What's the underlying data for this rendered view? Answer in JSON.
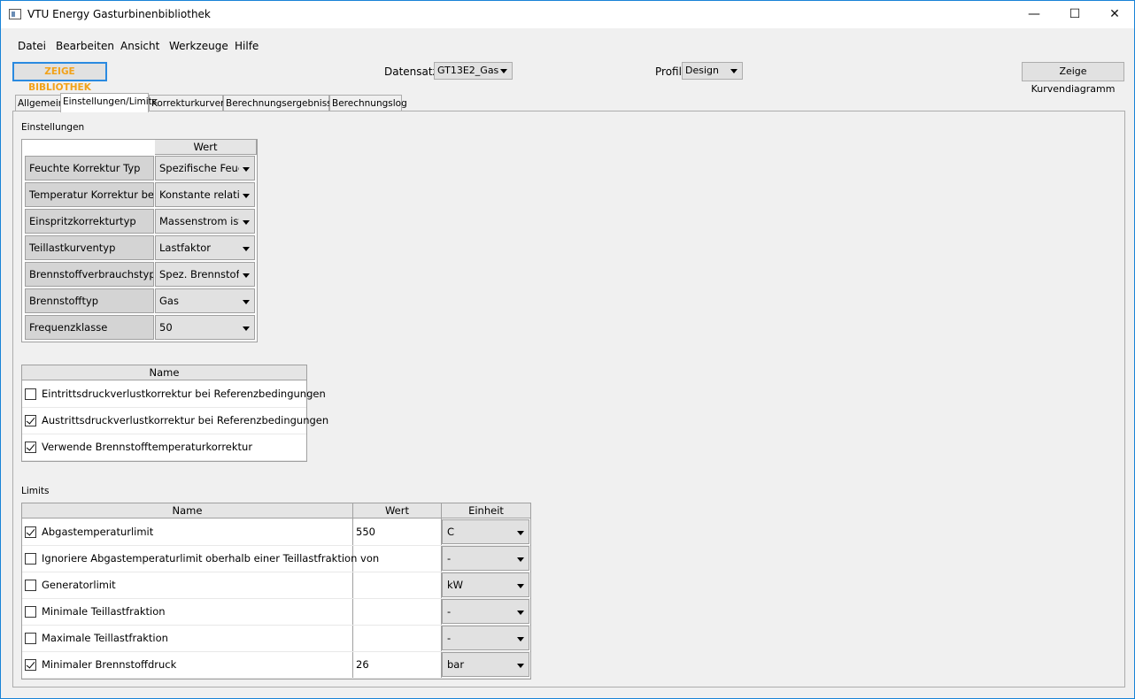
{
  "window": {
    "title": "VTU Energy Gasturbinenbibliothek"
  },
  "menu": [
    "Datei",
    "Bearbeiten",
    "Ansicht",
    "Werkzeuge",
    "Hilfe"
  ],
  "toolbar": {
    "library_button": "ZEIGE BIBLIOTHEK",
    "dataset_label": "Datensatz",
    "dataset_value": "GT13E2_Gas",
    "profile_label": "Profil",
    "profile_value": "Design",
    "curve_button": "Zeige Kurvendiagramm"
  },
  "tabs": [
    "Allgemein",
    "Einstellungen/Limits",
    "Korrekturkurven",
    "Berechnungsergebnisse",
    "Berechnungslog"
  ],
  "active_tab": "Einstellungen/Limits",
  "settings": {
    "section_label": "Einstellungen",
    "value_header": "Wert",
    "rows": [
      {
        "name": "Feuchte Korrektur Typ",
        "value": "Spezifische Feuchte"
      },
      {
        "name": "Temperatur Korrektur bei",
        "value": "Konstante relative"
      },
      {
        "name": "Einspritzkorrekturtyp",
        "value": "Massenstrom ist"
      },
      {
        "name": "Teillastkurventyp",
        "value": "Lastfaktor"
      },
      {
        "name": "Brennstoffverbrauchstyp",
        "value": "Spez. Brennstoffb"
      },
      {
        "name": "Brennstofftyp",
        "value": "Gas"
      },
      {
        "name": "Frequenzklasse",
        "value": "50"
      }
    ]
  },
  "options": {
    "name_header": "Name",
    "rows": [
      {
        "label": "Eintrittsdruckverlustkorrektur bei Referenzbedingungen",
        "checked": false
      },
      {
        "label": "Austrittsdruckverlustkorrektur bei Referenzbedingungen",
        "checked": true
      },
      {
        "label": "Verwende Brennstofftemperaturkorrektur",
        "checked": true
      }
    ]
  },
  "limits": {
    "section_label": "Limits",
    "headers": {
      "name": "Name",
      "value": "Wert",
      "unit": "Einheit"
    },
    "rows": [
      {
        "name": "Abgastemperaturlimit",
        "checked": true,
        "value": "550",
        "unit": "C"
      },
      {
        "name": "Ignoriere Abgastemperaturlimit oberhalb einer Teillastfraktion von",
        "checked": false,
        "value": "",
        "unit": "-"
      },
      {
        "name": "Generatorlimit",
        "checked": false,
        "value": "",
        "unit": "kW"
      },
      {
        "name": "Minimale Teillastfraktion",
        "checked": false,
        "value": "",
        "unit": "-"
      },
      {
        "name": "Maximale Teillastfraktion",
        "checked": false,
        "value": "",
        "unit": "-"
      },
      {
        "name": "Minimaler Brennstoffdruck",
        "checked": true,
        "value": "26",
        "unit": "bar"
      }
    ]
  }
}
